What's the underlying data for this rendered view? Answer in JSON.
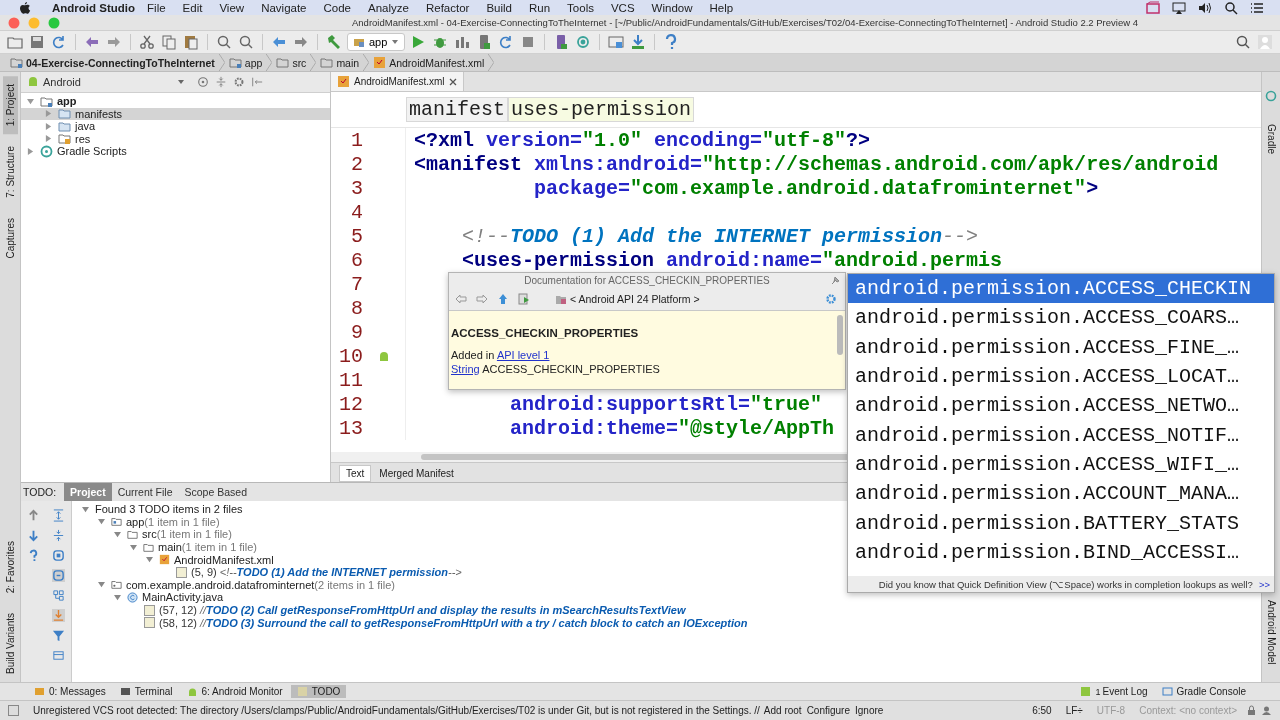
{
  "menubar": {
    "app_name": "Android Studio",
    "menus": [
      "File",
      "Edit",
      "View",
      "Navigate",
      "Code",
      "Analyze",
      "Refactor",
      "Build",
      "Run",
      "Tools",
      "VCS",
      "Window",
      "Help"
    ]
  },
  "window": {
    "title": "AndroidManifest.xml - 04-Exercise-ConnectingToTheInternet - [~/Public/AndroidFundamentals/GitHub/Exercises/T02/04-Exercise-ConnectingToTheInternet] - Android Studio 2.2 Preview 4"
  },
  "toolbar": {
    "run_config": "app"
  },
  "nav_bar": {
    "crumbs": [
      {
        "label": "04-Exercise-ConnectingToTheInternet",
        "kind": "module"
      },
      {
        "label": "app",
        "kind": "module"
      },
      {
        "label": "src",
        "kind": "folder"
      },
      {
        "label": "main",
        "kind": "folder"
      },
      {
        "label": "AndroidManifest.xml",
        "kind": "manifest"
      }
    ]
  },
  "left_stripe": {
    "top": [
      {
        "label": "1: Project",
        "selected": true
      },
      {
        "label": "7: Structure",
        "selected": false
      },
      {
        "label": "Captures",
        "selected": false
      }
    ],
    "bottom": [
      {
        "label": "2: Favorites",
        "selected": false
      },
      {
        "label": "Build Variants",
        "selected": false
      }
    ]
  },
  "right_stripe": [
    {
      "label": "Gradle"
    },
    {
      "label": "Android Model"
    }
  ],
  "project_panel": {
    "view": "Android",
    "tree": [
      {
        "label": "app",
        "kind": "module",
        "expanded": true,
        "selected": false,
        "children": [
          {
            "label": "manifests",
            "kind": "folder",
            "expanded": false,
            "selected": true
          },
          {
            "label": "java",
            "kind": "folder",
            "expanded": false,
            "selected": false
          },
          {
            "label": "res",
            "kind": "res",
            "expanded": false,
            "selected": false
          }
        ]
      },
      {
        "label": "Gradle Scripts",
        "kind": "gradle",
        "expanded": false,
        "selected": false
      }
    ]
  },
  "editor": {
    "tabs": [
      {
        "label": "AndroidManifest.xml",
        "selected": true
      }
    ],
    "breadcrumbs": [
      "manifest",
      "uses-permission"
    ],
    "lines": [
      {
        "number": "1",
        "segments": [
          {
            "text": "<?xml",
            "kind": "tag"
          },
          {
            "text": " version=",
            "kind": "attr"
          },
          {
            "text": "\"1.0\"",
            "kind": "value"
          },
          {
            "text": " encoding=",
            "kind": "attr"
          },
          {
            "text": "\"utf-8\"",
            "kind": "value"
          },
          {
            "text": "?>",
            "kind": "tag"
          }
        ]
      },
      {
        "number": "2",
        "segments": [
          {
            "text": "<manifest",
            "kind": "tag"
          },
          {
            "text": " xmlns:android=",
            "kind": "attr"
          },
          {
            "text": "\"http://schemas.android.com/apk/res/android",
            "kind": "value"
          }
        ]
      },
      {
        "number": "3",
        "segments": [
          {
            "text": "          package=",
            "kind": "attr"
          },
          {
            "text": "\"com.example.android.datafrominternet\"",
            "kind": "value"
          },
          {
            "text": ">",
            "kind": "tag"
          }
        ]
      },
      {
        "number": "4"
      },
      {
        "number": "5",
        "segments": [
          {
            "text": "    <!--",
            "kind": "comment"
          },
          {
            "text": "TODO (1) Add the INTERNET permission",
            "kind": "todo"
          },
          {
            "text": "-->",
            "kind": "comment"
          }
        ]
      },
      {
        "number": "6",
        "segments": [
          {
            "text": "    <uses-permission",
            "kind": "tag"
          },
          {
            "text": " android:name=",
            "kind": "attr"
          },
          {
            "text": "\"android.permis",
            "kind": "value"
          }
        ]
      },
      {
        "number": "7"
      },
      {
        "number": "8"
      },
      {
        "number": "9"
      },
      {
        "number": "10"
      },
      {
        "number": "11"
      },
      {
        "number": "12",
        "segments": [
          {
            "text": "        android:supportsRtl=",
            "kind": "attr"
          },
          {
            "text": "\"true\"",
            "kind": "value"
          }
        ]
      },
      {
        "number": "13",
        "segments": [
          {
            "text": "        android:theme=",
            "kind": "attr"
          },
          {
            "text": "\"@style/AppTh",
            "kind": "value"
          }
        ]
      }
    ],
    "bottom_tabs": [
      {
        "label": "Text",
        "selected": true
      },
      {
        "label": "Merged Manifest",
        "selected": false
      }
    ]
  },
  "documentation_popup": {
    "title": "Documentation for ACCESS_CHECKIN_PROPERTIES",
    "location": "< Android API 24 Platform >",
    "heading": "ACCESS_CHECKIN_PROPERTIES",
    "added_prefix": "Added in",
    "added_link": "API level 1",
    "type_link": "String",
    "type_name": "ACCESS_CHECKIN_PROPERTIES"
  },
  "completion_popup": {
    "items": [
      {
        "text": "android.permission.ACCESS_CHECKIN",
        "selected": true
      },
      {
        "text": "android.permission.ACCESS_COARS…",
        "selected": false
      },
      {
        "text": "android.permission.ACCESS_FINE_…",
        "selected": false
      },
      {
        "text": "android.permission.ACCESS_LOCAT…",
        "selected": false
      },
      {
        "text": "android.permission.ACCESS_NETWO…",
        "selected": false
      },
      {
        "text": "android.permission.ACCESS_NOTIF…",
        "selected": false
      },
      {
        "text": "android.permission.ACCESS_WIFI_…",
        "selected": false
      },
      {
        "text": "android.permission.ACCOUNT_MANA…",
        "selected": false
      },
      {
        "text": "android.permission.BATTERY_STATS",
        "selected": false
      },
      {
        "text": "android.permission.BIND_ACCESSI…",
        "selected": false
      }
    ],
    "hint": "Did you know that Quick Definition View (⌥Space) works in completion lookups as well?",
    "more": ">>"
  },
  "todo_panel": {
    "label": "TODO:",
    "tabs": [
      {
        "label": "Project",
        "selected": true
      },
      {
        "label": "Current File",
        "selected": false
      },
      {
        "label": "Scope Based",
        "selected": false
      }
    ],
    "tree": [
      {
        "label": "Found 3 TODO items in 2 files",
        "expanded": true,
        "children": [
          {
            "label": "app",
            "detail": "(1 item in 1 file)",
            "kind": "module",
            "expanded": true,
            "children": [
              {
                "label": "src",
                "detail": "(1 item in 1 file)",
                "kind": "folder",
                "expanded": true,
                "children": [
                  {
                    "label": "main",
                    "detail": "(1 item in 1 file)",
                    "kind": "folder",
                    "expanded": true,
                    "children": [
                      {
                        "label": "AndroidManifest.xml",
                        "kind": "manifest",
                        "expanded": true,
                        "children": [
                          {
                            "kind": "todo",
                            "position": "(5, 9)",
                            "prefix": "<!--",
                            "text": "TODO (1) Add the INTERNET permission",
                            "suffix": "-->"
                          }
                        ]
                      }
                    ]
                  }
                ]
              }
            ]
          },
          {
            "label": "com.example.android.datafrominternet",
            "detail": "(2 items in 1 file)",
            "kind": "package",
            "expanded": true,
            "children": [
              {
                "label": "MainActivity.java",
                "kind": "java",
                "expanded": true,
                "children": [
                  {
                    "kind": "todo",
                    "position": "(57, 12)",
                    "prefix": "//",
                    "text": "TODO (2) Call getResponseFromHttpUrl and display the results in mSearchResultsTextView"
                  },
                  {
                    "kind": "todo",
                    "position": "(58, 12)",
                    "prefix": "//",
                    "text": "TODO (3) Surround the call to getResponseFromHttpUrl with a try / catch block to catch an IOException"
                  }
                ]
              }
            ]
          }
        ]
      }
    ]
  },
  "tool_tabs": {
    "left": [
      {
        "label": "0: Messages",
        "kind": "messages",
        "selected": false
      },
      {
        "label": "Terminal",
        "kind": "terminal",
        "selected": false
      },
      {
        "label": "6: Android Monitor",
        "kind": "android",
        "selected": false
      },
      {
        "label": "TODO",
        "kind": "todo",
        "selected": true
      }
    ],
    "right": [
      {
        "label": "Event Log",
        "badge": "1",
        "kind": "log"
      },
      {
        "label": "Gradle Console",
        "kind": "console"
      }
    ]
  },
  "status_bar": {
    "message": "Unregistered VCS root detected: The directory /Users/clamps/Public/AndroidFundamentals/GitHub/Exercises/T02 is under Git, but is not registered in the Settings. //",
    "links": [
      "Add root",
      "Configure",
      "Ignore"
    ],
    "position": "6:50",
    "line_separator": "LF÷",
    "encoding": "UTF-8",
    "context": "Context: <no context>"
  }
}
